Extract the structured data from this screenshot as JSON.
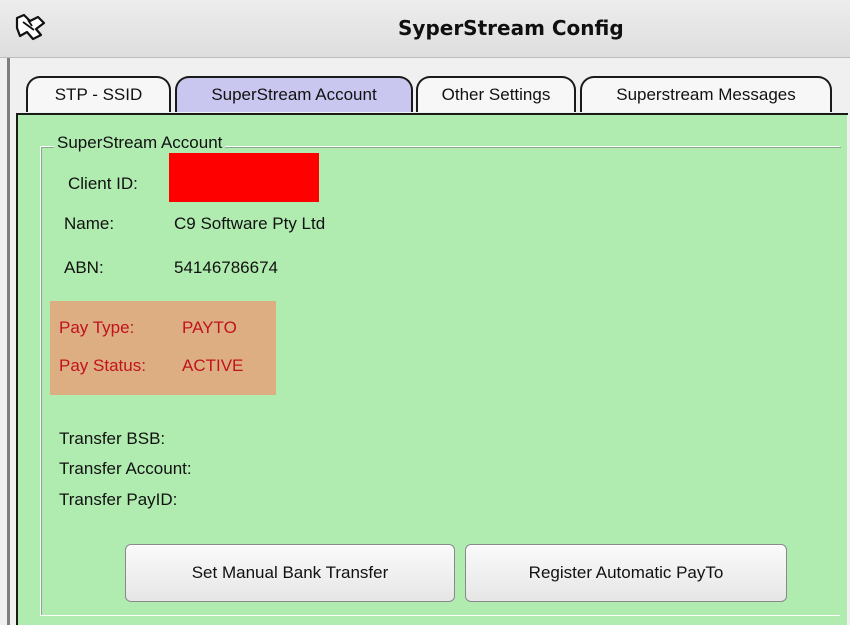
{
  "window": {
    "title": "SyperStream Config"
  },
  "icons": {
    "app": "app-icon"
  },
  "tabs": [
    {
      "label": "STP - SSID",
      "active": false
    },
    {
      "label": "SuperStream Account",
      "active": true
    },
    {
      "label": "Other Settings",
      "active": false
    },
    {
      "label": "Superstream Messages",
      "active": false
    }
  ],
  "account": {
    "group_title": "SuperStream Account",
    "client_id_label": "Client ID:",
    "client_id_value": "",
    "name_label": "Name:",
    "name_value": "C9 Software Pty Ltd",
    "abn_label": "ABN:",
    "abn_value": "54146786674",
    "pay_type_label": "Pay Type:",
    "pay_type_value": "PAYTO",
    "pay_status_label": "Pay Status:",
    "pay_status_value": "ACTIVE",
    "transfer_bsb_label": "Transfer BSB:",
    "transfer_account_label": "Transfer Account:",
    "transfer_payid_label": "Transfer PayID:"
  },
  "buttons": {
    "manual_transfer": "Set Manual Bank Transfer",
    "register_payto": "Register Automatic PayTo"
  },
  "colors": {
    "panel_bg": "#b0ecb0",
    "active_tab_bg": "#c9c6f0",
    "pay_box_bg": "#dcae82",
    "pay_text": "#c1121f",
    "redaction": "#ff0000"
  }
}
